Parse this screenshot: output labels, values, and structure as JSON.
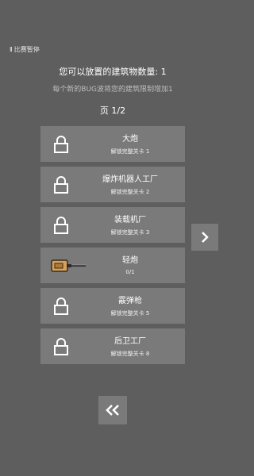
{
  "pause": {
    "icon": "pause-icon",
    "label": "比赛暂停"
  },
  "header": {
    "title": "您可以放置的建筑物数量: 1",
    "subtitle": "每个新的BUG波将您的建筑限制增加1",
    "page_label": "页 1/2"
  },
  "buildings": [
    {
      "name": "大炮",
      "status": "解锁完整关卡 1",
      "locked": true
    },
    {
      "name": "爆炸机器人工厂",
      "status": "解锁完整关卡 2",
      "locked": true
    },
    {
      "name": "装载机厂",
      "status": "解锁完整关卡 3",
      "locked": true
    },
    {
      "name": "轻炮",
      "status": "0/1",
      "locked": false
    },
    {
      "name": "霰弹枪",
      "status": "解锁完整关卡 5",
      "locked": true
    },
    {
      "name": "后卫工厂",
      "status": "解锁完整关卡 8",
      "locked": true
    }
  ],
  "nav": {
    "next_icon": "chevron-right-icon",
    "back_icon": "double-chevron-left-icon"
  }
}
